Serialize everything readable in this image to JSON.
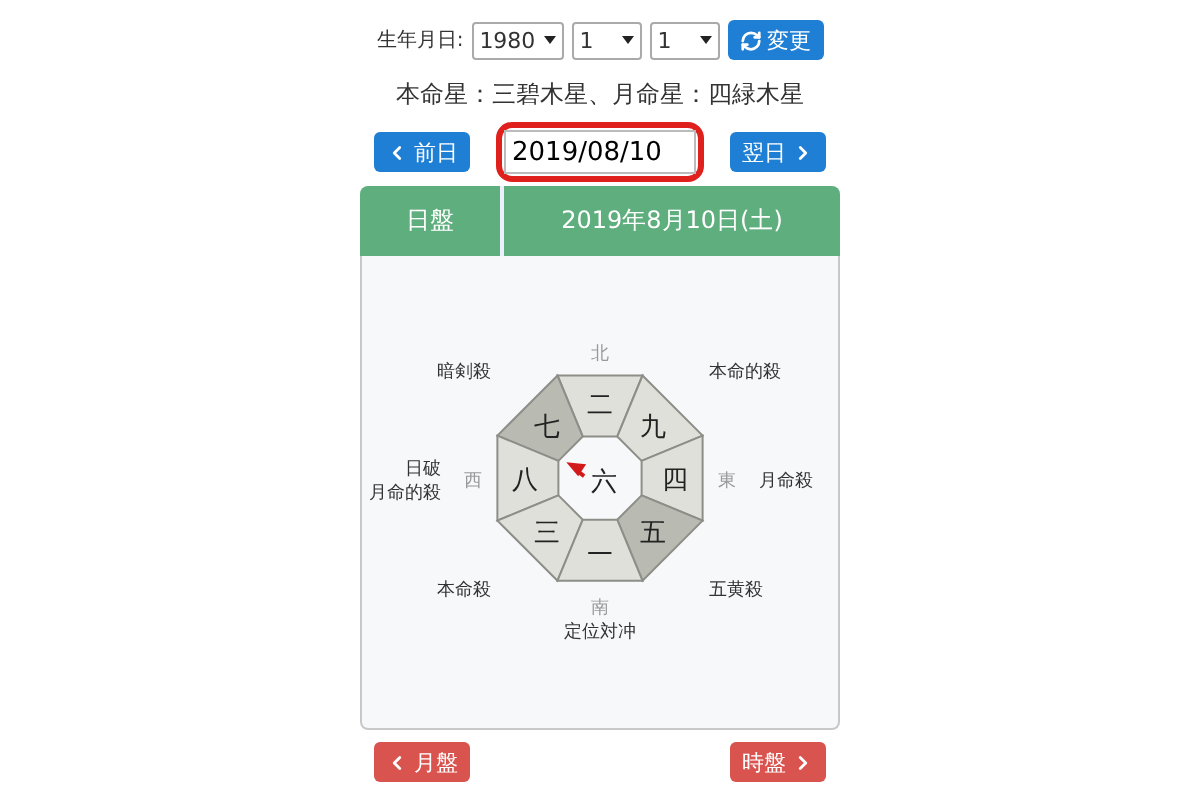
{
  "birth": {
    "label": "生年月日:",
    "year": "1980",
    "month": "1",
    "day": "1",
    "change_button": "変更"
  },
  "stars_line": "本命星：三碧木星、月命星：四緑木星",
  "nav": {
    "prev": "前日",
    "date": "2019/08/10",
    "next": "翌日",
    "highlighted": true
  },
  "board": {
    "type_label": "日盤",
    "date": "2019年8月10日(土)",
    "center": "六",
    "sectors": [
      {
        "kind": "north",
        "number": "二",
        "shaded": false,
        "direction": "北"
      },
      {
        "kind": "northwest",
        "number": "七",
        "shaded": true,
        "marks": [
          "暗剣殺"
        ]
      },
      {
        "kind": "northeast",
        "number": "九",
        "shaded": false,
        "marks": [
          "本命的殺"
        ]
      },
      {
        "kind": "west",
        "number": "八",
        "shaded": false,
        "direction": "西",
        "marks": [
          "日破",
          "月命的殺"
        ]
      },
      {
        "kind": "east",
        "number": "四",
        "shaded": false,
        "direction": "東",
        "marks": [
          "月命殺"
        ]
      },
      {
        "kind": "southwest",
        "number": "三",
        "shaded": false,
        "marks": [
          "本命殺"
        ]
      },
      {
        "kind": "southeast",
        "number": "五",
        "shaded": true,
        "marks": [
          "五黄殺"
        ]
      },
      {
        "kind": "south",
        "number": "一",
        "shaded": false,
        "direction": "南",
        "marks": [
          "定位対冲"
        ]
      }
    ]
  },
  "bottom": {
    "prev": "月盤",
    "next": "時盤"
  }
}
